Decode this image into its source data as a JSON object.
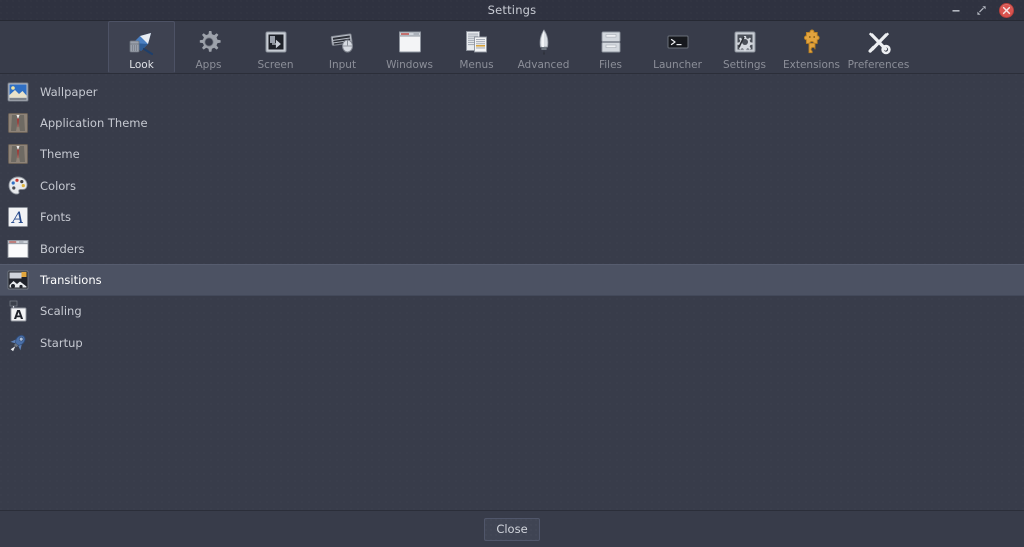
{
  "window": {
    "title": "Settings",
    "controls": [
      {
        "name": "minimize",
        "glyph": "minimize-icon"
      },
      {
        "name": "maximize",
        "glyph": "maximize-icon"
      },
      {
        "name": "close",
        "glyph": "close-icon"
      }
    ]
  },
  "toolbar": {
    "selected": "Look",
    "items": [
      {
        "label": "Look",
        "icon": "look-icon",
        "selected": true
      },
      {
        "label": "Apps",
        "icon": "apps-gear-icon",
        "selected": false
      },
      {
        "label": "Screen",
        "icon": "screen-icon",
        "selected": false
      },
      {
        "label": "Input",
        "icon": "input-keyboard-mouse-icon",
        "selected": false
      },
      {
        "label": "Windows",
        "icon": "windows-icon",
        "selected": false
      },
      {
        "label": "Menus",
        "icon": "menus-icon",
        "selected": false
      },
      {
        "label": "Advanced",
        "icon": "advanced-feather-icon",
        "selected": false
      },
      {
        "label": "Files",
        "icon": "files-icon",
        "selected": false
      },
      {
        "label": "Launcher",
        "icon": "launcher-terminal-icon",
        "selected": false
      },
      {
        "label": "Settings",
        "icon": "settings-icon",
        "selected": false
      },
      {
        "label": "Extensions",
        "icon": "extensions-puzzle-icon",
        "selected": false
      },
      {
        "label": "Preferences",
        "icon": "preferences-tools-icon",
        "selected": false
      }
    ]
  },
  "list": {
    "items": [
      {
        "label": "Wallpaper",
        "icon": "wallpaper-icon",
        "selected": false
      },
      {
        "label": "Application Theme",
        "icon": "suit-theme-icon",
        "selected": false
      },
      {
        "label": "Theme",
        "icon": "suit-theme-icon",
        "selected": false
      },
      {
        "label": "Colors",
        "icon": "palette-icon",
        "selected": false
      },
      {
        "label": "Fonts",
        "icon": "font-a-icon",
        "selected": false
      },
      {
        "label": "Borders",
        "icon": "border-window-icon",
        "selected": false
      },
      {
        "label": "Transitions",
        "icon": "transitions-icon",
        "selected": true
      },
      {
        "label": "Scaling",
        "icon": "scaling-a-icon",
        "selected": false
      },
      {
        "label": "Startup",
        "icon": "startup-rocket-icon",
        "selected": false
      }
    ]
  },
  "footer": {
    "close_label": "Close"
  },
  "colors": {
    "window_bg": "#383c4a",
    "titlebar_bg": "#2f3240",
    "selection_bg": "#4c5263",
    "close_button_red": "#d9534f",
    "text": "#c6c9d1",
    "muted_text": "#8c8f99"
  }
}
